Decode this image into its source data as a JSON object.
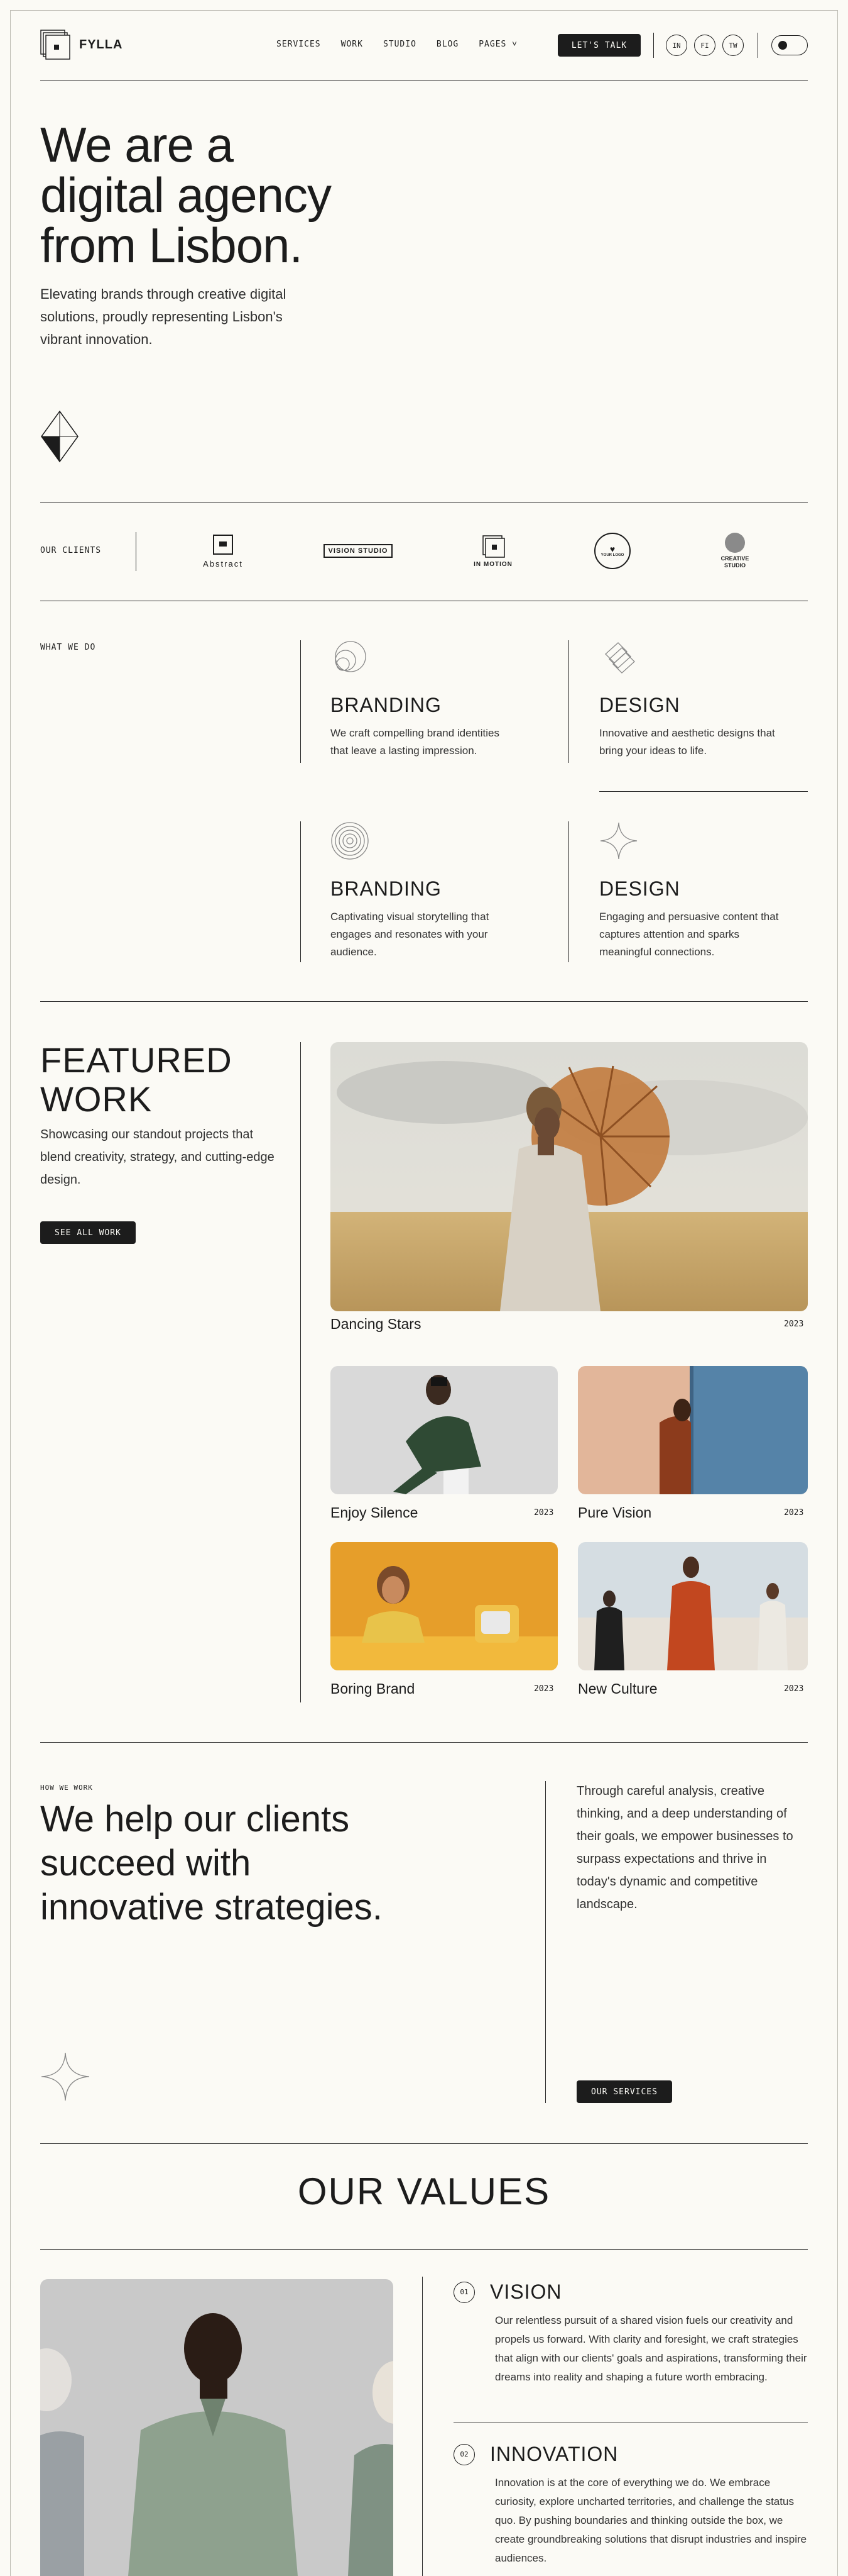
{
  "header": {
    "brand": "FYLLA",
    "nav": [
      "SERVICES",
      "WORK",
      "STUDIO",
      "BLOG",
      "PAGES ˅"
    ],
    "cta": "LET'S TALK",
    "social": [
      "IN",
      "FI",
      "TW"
    ]
  },
  "hero": {
    "title_lines": [
      "We are a",
      "digital agency",
      "from Lisbon."
    ],
    "subtitle": "Elevating brands through creative digital solutions, proudly representing Lisbon's vibrant innovation."
  },
  "clients": {
    "label": "OUR CLIENTS",
    "logos": [
      "Abstract",
      "VISION STUDIO",
      "IN MOTION",
      "YOUR LOGO",
      "CREATIVE STUDIO"
    ]
  },
  "services": {
    "label": "WHAT WE DO",
    "items": [
      {
        "title": "BRANDING",
        "desc": "We craft compelling brand identities that leave a lasting impression."
      },
      {
        "title": "DESIGN",
        "desc": "Innovative and aesthetic designs that bring your ideas to life."
      },
      {
        "title": "BRANDING",
        "desc": "Captivating visual storytelling that engages and resonates with your audience."
      },
      {
        "title": "DESIGN",
        "desc": "Engaging and persuasive content that captures attention and sparks meaningful connections."
      }
    ]
  },
  "featured": {
    "title_lines": [
      "FEATURED",
      "WORK"
    ],
    "desc": "Showcasing our standout projects that blend creativity, strategy, and cutting-edge design.",
    "button": "SEE ALL WORK",
    "works": [
      {
        "name": "Dancing Stars",
        "year": "2023"
      },
      {
        "name": "Enjoy Silence",
        "year": "2023"
      },
      {
        "name": "Pure Vision",
        "year": "2023"
      },
      {
        "name": "Boring Brand",
        "year": "2023"
      },
      {
        "name": "New Culture",
        "year": "2023"
      }
    ]
  },
  "how": {
    "label": "HOW WE WORK",
    "title_lines": [
      "We help our clients",
      "succeed with",
      "innovative strategies."
    ],
    "text": "Through careful analysis, creative thinking, and a deep understanding of their goals, we empower businesses to surpass expectations and thrive in today's dynamic and competitive landscape.",
    "button": "OUR SERVICES"
  },
  "values": {
    "title": "OUR VALUES",
    "items": [
      {
        "num": "01",
        "title": "VISION",
        "text": "Our relentless pursuit of a shared vision fuels our creativity and propels us forward. With clarity and foresight, we craft strategies that align with our clients' goals and aspirations, transforming their dreams into reality and shaping a future worth embracing."
      },
      {
        "num": "02",
        "title": "INNOVATION",
        "text": "Innovation is at the core of everything we do. We embrace curiosity, explore uncharted territories, and challenge the status quo. By pushing boundaries and thinking outside the box, we create groundbreaking solutions that disrupt industries and inspire audiences."
      }
    ]
  },
  "colors": {
    "background": "#fbfaf5",
    "ink": "#1c1c1c"
  }
}
